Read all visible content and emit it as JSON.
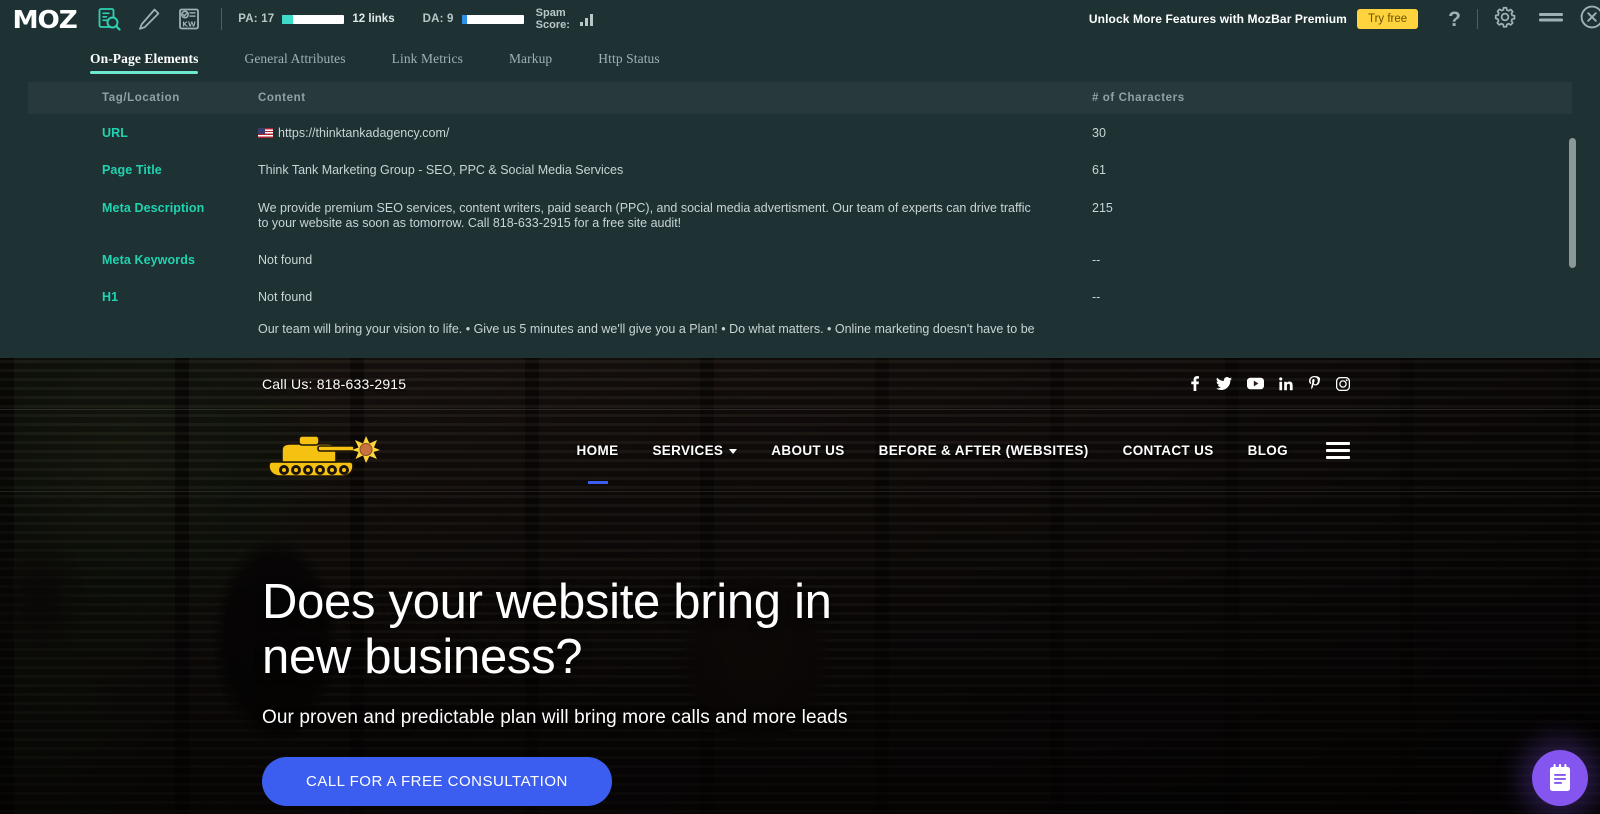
{
  "mozbar": {
    "brand": "MOZ",
    "icons": [
      {
        "name": "page-analysis-icon",
        "label": "Page Analysis"
      },
      {
        "name": "highlighter-pencil-icon",
        "label": "Highlighter"
      },
      {
        "name": "keyword-icon",
        "label": "Keyword"
      }
    ],
    "metrics": {
      "pa_label": "PA: 17",
      "pa_value": 17,
      "pa_color": "#3ddbc8",
      "links": "12 links",
      "da_label": "DA: 9",
      "da_value": 9,
      "da_color": "#2c8fe8",
      "spam_label_line1": "Spam",
      "spam_label_line2": "Score:"
    },
    "promo": {
      "text": "Unlock More Features with MozBar Premium",
      "button": "Try free",
      "button_color": "#ffd33d"
    },
    "controls": {
      "help": "?",
      "gear": "gear-icon",
      "minimize": "minimize-icon",
      "close": "close-icon"
    },
    "tabs": [
      {
        "label": "On-Page Elements",
        "active": true
      },
      {
        "label": "General Attributes",
        "active": false
      },
      {
        "label": "Link Metrics",
        "active": false
      },
      {
        "label": "Markup",
        "active": false
      },
      {
        "label": "Http Status",
        "active": false
      }
    ],
    "accent": "#6ee8cf",
    "table": {
      "headers": [
        "Tag/Location",
        "Content",
        "# of Characters"
      ],
      "rows": [
        {
          "tag": "URL",
          "content": "https://thinktankadagency.com/",
          "chars": "30",
          "has_flag": true
        },
        {
          "tag": "Page Title",
          "content": "Think Tank Marketing Group - SEO, PPC & Social Media Services",
          "chars": "61",
          "has_flag": false
        },
        {
          "tag": "Meta Description",
          "content": "We provide premium SEO services, content writers, paid search (PPC), and social media advertisment. Our team of experts can drive traffic to your website as soon as tomorrow. Call 818-633-2915 for a free site audit!",
          "chars": "215",
          "has_flag": false
        },
        {
          "tag": "Meta Keywords",
          "content": "Not found",
          "chars": "--",
          "has_flag": false
        },
        {
          "tag": "H1",
          "content": "Not found",
          "chars": "--",
          "has_flag": false
        }
      ],
      "partial_row": {
        "content": "Our team will bring your vision to life. • Give us 5 minutes and we'll give you a Plan! • Do what matters. • Online marketing doesn't have to be"
      }
    }
  },
  "site": {
    "topbar": {
      "call_us": "Call Us: 818-633-2915",
      "socials": [
        "facebook-icon",
        "twitter-icon",
        "youtube-icon",
        "linkedin-icon",
        "pinterest-icon",
        "instagram-icon"
      ]
    },
    "nav": {
      "logo": "think-tank-tank-logo",
      "links": [
        {
          "label": "HOME",
          "current": true,
          "dropdown": false
        },
        {
          "label": "SERVICES",
          "current": false,
          "dropdown": true
        },
        {
          "label": "ABOUT US",
          "current": false,
          "dropdown": false
        },
        {
          "label": "BEFORE & AFTER (WEBSITES)",
          "current": false,
          "dropdown": false
        },
        {
          "label": "CONTACT US",
          "current": false,
          "dropdown": false
        },
        {
          "label": "BLOG",
          "current": false,
          "dropdown": false
        }
      ],
      "menu_icon": "hamburger-icon",
      "current_color": "#3b5ef0"
    },
    "hero": {
      "heading_line1": "Does your website bring in",
      "heading_line2": "new business?",
      "subheading": "Our proven and predictable plan will bring more calls and more leads",
      "cta": "CALL FOR A FREE CONSULTATION",
      "cta_color": "#3b5ef0"
    },
    "chat_widget": {
      "name": "form-chat-widget",
      "color": "#8456ef"
    }
  }
}
